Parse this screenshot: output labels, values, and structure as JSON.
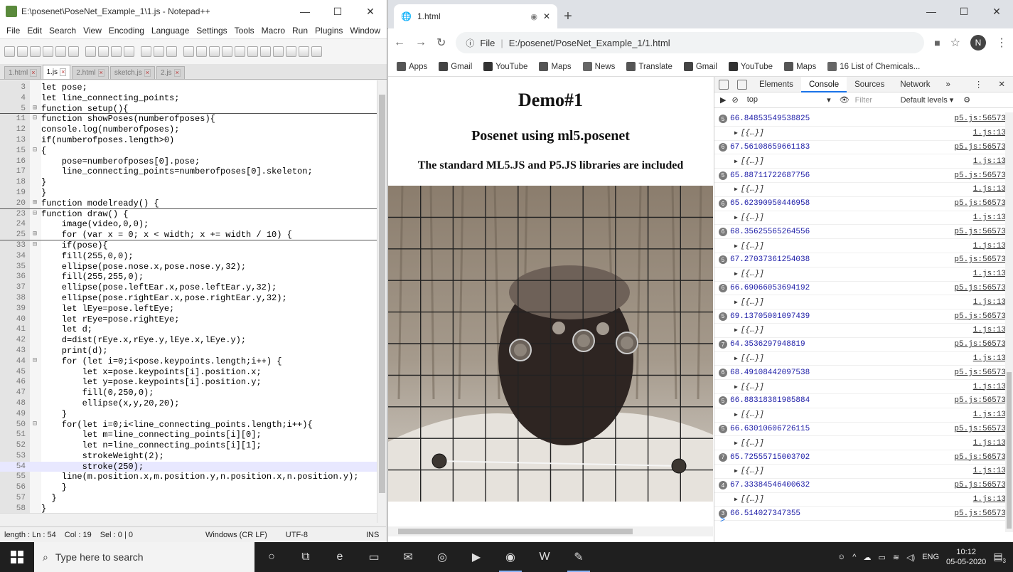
{
  "notepad": {
    "title": "E:\\posenet\\PoseNet_Example_1\\1.js - Notepad++",
    "menu": [
      "File",
      "Edit",
      "Search",
      "View",
      "Encoding",
      "Language",
      "Settings",
      "Tools",
      "Macro",
      "Run",
      "Plugins",
      "Window",
      "?"
    ],
    "tabs": [
      {
        "label": "1.html",
        "active": false
      },
      {
        "label": "1.js",
        "active": true
      },
      {
        "label": "2.html",
        "active": false
      },
      {
        "label": "sketch.js",
        "active": false
      },
      {
        "label": "2.js",
        "active": false
      }
    ],
    "code_lines": [
      {
        "n": "3",
        "f": "",
        "t": "let pose;"
      },
      {
        "n": "4",
        "f": "",
        "t": "let line_connecting_points;"
      },
      {
        "n": "5",
        "f": "⊞",
        "t": "function setup(){",
        "sep": true
      },
      {
        "n": "11",
        "f": "⊟",
        "t": "function showPoses(numberofposes){"
      },
      {
        "n": "12",
        "f": "",
        "t": "console.log(numberofposes);"
      },
      {
        "n": "13",
        "f": "",
        "t": "if(numberofposes.length>0)"
      },
      {
        "n": "15",
        "f": "⊟",
        "t": "{"
      },
      {
        "n": "16",
        "f": "",
        "t": "    pose=numberofposes[0].pose;"
      },
      {
        "n": "17",
        "f": "",
        "t": "    line_connecting_points=numberofposes[0].skeleton;"
      },
      {
        "n": "18",
        "f": "",
        "t": "}"
      },
      {
        "n": "19",
        "f": "",
        "t": "}"
      },
      {
        "n": "20",
        "f": "⊞",
        "t": "function modelready() {",
        "sep": true
      },
      {
        "n": "23",
        "f": "⊟",
        "t": "function draw() {"
      },
      {
        "n": "24",
        "f": "",
        "t": "    image(video,0,0);"
      },
      {
        "n": "25",
        "f": "⊞",
        "t": "    for (var x = 0; x < width; x += width / 10) {",
        "sep": true
      },
      {
        "n": "33",
        "f": "⊟",
        "t": "    if(pose){"
      },
      {
        "n": "34",
        "f": "",
        "t": "    fill(255,0,0);"
      },
      {
        "n": "35",
        "f": "",
        "t": "    ellipse(pose.nose.x,pose.nose.y,32);"
      },
      {
        "n": "36",
        "f": "",
        "t": "    fill(255,255,0);"
      },
      {
        "n": "37",
        "f": "",
        "t": "    ellipse(pose.leftEar.x,pose.leftEar.y,32);"
      },
      {
        "n": "38",
        "f": "",
        "t": "    ellipse(pose.rightEar.x,pose.rightEar.y,32);"
      },
      {
        "n": "39",
        "f": "",
        "t": "    let lEye=pose.leftEye;"
      },
      {
        "n": "40",
        "f": "",
        "t": "    let rEye=pose.rightEye;"
      },
      {
        "n": "41",
        "f": "",
        "t": "    let d;"
      },
      {
        "n": "42",
        "f": "",
        "t": "    d=dist(rEye.x,rEye.y,lEye.x,lEye.y);"
      },
      {
        "n": "43",
        "f": "",
        "t": "    print(d);"
      },
      {
        "n": "44",
        "f": "⊟",
        "t": "    for (let i=0;i<pose.keypoints.length;i++) {"
      },
      {
        "n": "45",
        "f": "",
        "t": "        let x=pose.keypoints[i].position.x;"
      },
      {
        "n": "46",
        "f": "",
        "t": "        let y=pose.keypoints[i].position.y;"
      },
      {
        "n": "47",
        "f": "",
        "t": "        fill(0,250,0);"
      },
      {
        "n": "48",
        "f": "",
        "t": "        ellipse(x,y,20,20);"
      },
      {
        "n": "49",
        "f": "",
        "t": "    }"
      },
      {
        "n": "50",
        "f": "⊟",
        "t": "    for(let i=0;i<line_connecting_points.length;i++){"
      },
      {
        "n": "51",
        "f": "",
        "t": "        let m=line_connecting_points[i][0];"
      },
      {
        "n": "52",
        "f": "",
        "t": "        let n=line_connecting_points[i][1];"
      },
      {
        "n": "53",
        "f": "",
        "t": "        strokeWeight(2);"
      },
      {
        "n": "54",
        "f": "",
        "t": "        stroke(250);",
        "cur": true
      },
      {
        "n": "55",
        "f": "",
        "t": "    line(m.position.x,m.position.y,n.position.x,n.position.y);"
      },
      {
        "n": "56",
        "f": "",
        "t": "    }"
      },
      {
        "n": "57",
        "f": "",
        "t": "  }"
      },
      {
        "n": "58",
        "f": "",
        "t": "}"
      }
    ],
    "status": {
      "length": "length : Ln : 54",
      "col": "Col : 19",
      "sel": "Sel : 0 | 0",
      "eol": "Windows (CR LF)",
      "encoding": "UTF-8",
      "mode": "INS"
    }
  },
  "chrome": {
    "tab_title": "1.html",
    "url_scheme": "File",
    "url": "E:/posenet/PoseNet_Example_1/1.html",
    "avatar": "N",
    "bookmarks": [
      {
        "label": "Apps",
        "color": "#555555"
      },
      {
        "label": "Gmail",
        "color": "#444444"
      },
      {
        "label": "YouTube",
        "color": "#333333"
      },
      {
        "label": "Maps",
        "color": "#555555"
      },
      {
        "label": "News",
        "color": "#666666"
      },
      {
        "label": "Translate",
        "color": "#555555"
      },
      {
        "label": "Gmail",
        "color": "#444444"
      },
      {
        "label": "YouTube",
        "color": "#333333"
      },
      {
        "label": "Maps",
        "color": "#555555"
      },
      {
        "label": "16 List of Chemicals...",
        "color": "#666666"
      }
    ]
  },
  "page": {
    "h1": "Demo#1",
    "h2": "Posenet using ml5.posenet",
    "h3": "The standard ML5.JS and P5.JS libraries are included"
  },
  "devtools": {
    "tabs": [
      "Elements",
      "Console",
      "Sources",
      "Network"
    ],
    "active_tab": "Console",
    "more": "»",
    "context": "top",
    "filter_placeholder": "Filter",
    "levels": "Default levels ▾",
    "object_text": "[{…}]",
    "src_num": "p5.js:56573",
    "src_obj": "1.js:13",
    "log": [
      {
        "count": "5",
        "value": "66.84853549538825"
      },
      {
        "count": "6",
        "value": "67.56108659661183"
      },
      {
        "count": "5",
        "value": "65.88711722687756"
      },
      {
        "count": "6",
        "value": "65.62390950446958"
      },
      {
        "count": "6",
        "value": "68.35625565264556"
      },
      {
        "count": "5",
        "value": "67.27037361254038"
      },
      {
        "count": "6",
        "value": "66.69066053694192"
      },
      {
        "count": "5",
        "value": "69.13705001097439"
      },
      {
        "count": "7",
        "value": "64.3536297948819"
      },
      {
        "count": "6",
        "value": "68.49108442097538"
      },
      {
        "count": "5",
        "value": "66.88318381985884"
      },
      {
        "count": "5",
        "value": "66.63010606726115"
      },
      {
        "count": "7",
        "value": "65.72555715003702"
      },
      {
        "count": "4",
        "value": "67.33384546400632"
      },
      {
        "count": "3",
        "value": "66.514027347355"
      }
    ],
    "prompt": ">"
  },
  "taskbar": {
    "search_placeholder": "Type here to search",
    "lang": "ENG",
    "time": "10:12",
    "date": "05-05-2020",
    "notif_count": "3"
  }
}
